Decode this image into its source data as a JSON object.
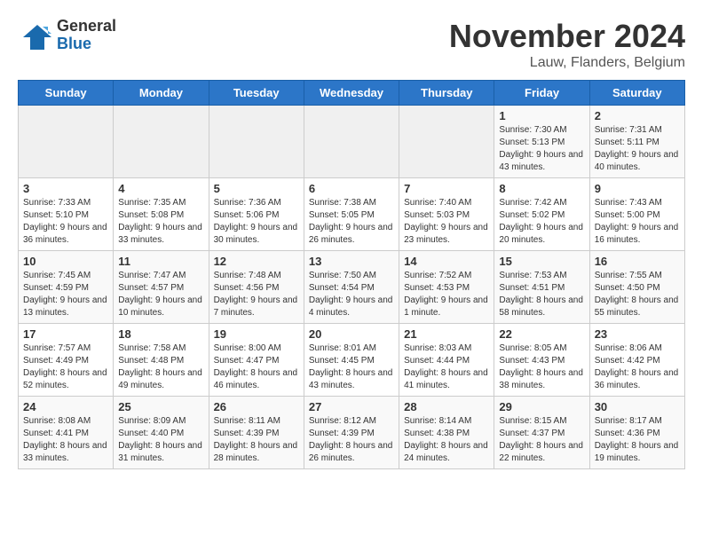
{
  "logo": {
    "general": "General",
    "blue": "Blue"
  },
  "title": "November 2024",
  "subtitle": "Lauw, Flanders, Belgium",
  "days_of_week": [
    "Sunday",
    "Monday",
    "Tuesday",
    "Wednesday",
    "Thursday",
    "Friday",
    "Saturday"
  ],
  "weeks": [
    [
      {
        "day": "",
        "info": ""
      },
      {
        "day": "",
        "info": ""
      },
      {
        "day": "",
        "info": ""
      },
      {
        "day": "",
        "info": ""
      },
      {
        "day": "",
        "info": ""
      },
      {
        "day": "1",
        "info": "Sunrise: 7:30 AM\nSunset: 5:13 PM\nDaylight: 9 hours and 43 minutes."
      },
      {
        "day": "2",
        "info": "Sunrise: 7:31 AM\nSunset: 5:11 PM\nDaylight: 9 hours and 40 minutes."
      }
    ],
    [
      {
        "day": "3",
        "info": "Sunrise: 7:33 AM\nSunset: 5:10 PM\nDaylight: 9 hours and 36 minutes."
      },
      {
        "day": "4",
        "info": "Sunrise: 7:35 AM\nSunset: 5:08 PM\nDaylight: 9 hours and 33 minutes."
      },
      {
        "day": "5",
        "info": "Sunrise: 7:36 AM\nSunset: 5:06 PM\nDaylight: 9 hours and 30 minutes."
      },
      {
        "day": "6",
        "info": "Sunrise: 7:38 AM\nSunset: 5:05 PM\nDaylight: 9 hours and 26 minutes."
      },
      {
        "day": "7",
        "info": "Sunrise: 7:40 AM\nSunset: 5:03 PM\nDaylight: 9 hours and 23 minutes."
      },
      {
        "day": "8",
        "info": "Sunrise: 7:42 AM\nSunset: 5:02 PM\nDaylight: 9 hours and 20 minutes."
      },
      {
        "day": "9",
        "info": "Sunrise: 7:43 AM\nSunset: 5:00 PM\nDaylight: 9 hours and 16 minutes."
      }
    ],
    [
      {
        "day": "10",
        "info": "Sunrise: 7:45 AM\nSunset: 4:59 PM\nDaylight: 9 hours and 13 minutes."
      },
      {
        "day": "11",
        "info": "Sunrise: 7:47 AM\nSunset: 4:57 PM\nDaylight: 9 hours and 10 minutes."
      },
      {
        "day": "12",
        "info": "Sunrise: 7:48 AM\nSunset: 4:56 PM\nDaylight: 9 hours and 7 minutes."
      },
      {
        "day": "13",
        "info": "Sunrise: 7:50 AM\nSunset: 4:54 PM\nDaylight: 9 hours and 4 minutes."
      },
      {
        "day": "14",
        "info": "Sunrise: 7:52 AM\nSunset: 4:53 PM\nDaylight: 9 hours and 1 minute."
      },
      {
        "day": "15",
        "info": "Sunrise: 7:53 AM\nSunset: 4:51 PM\nDaylight: 8 hours and 58 minutes."
      },
      {
        "day": "16",
        "info": "Sunrise: 7:55 AM\nSunset: 4:50 PM\nDaylight: 8 hours and 55 minutes."
      }
    ],
    [
      {
        "day": "17",
        "info": "Sunrise: 7:57 AM\nSunset: 4:49 PM\nDaylight: 8 hours and 52 minutes."
      },
      {
        "day": "18",
        "info": "Sunrise: 7:58 AM\nSunset: 4:48 PM\nDaylight: 8 hours and 49 minutes."
      },
      {
        "day": "19",
        "info": "Sunrise: 8:00 AM\nSunset: 4:47 PM\nDaylight: 8 hours and 46 minutes."
      },
      {
        "day": "20",
        "info": "Sunrise: 8:01 AM\nSunset: 4:45 PM\nDaylight: 8 hours and 43 minutes."
      },
      {
        "day": "21",
        "info": "Sunrise: 8:03 AM\nSunset: 4:44 PM\nDaylight: 8 hours and 41 minutes."
      },
      {
        "day": "22",
        "info": "Sunrise: 8:05 AM\nSunset: 4:43 PM\nDaylight: 8 hours and 38 minutes."
      },
      {
        "day": "23",
        "info": "Sunrise: 8:06 AM\nSunset: 4:42 PM\nDaylight: 8 hours and 36 minutes."
      }
    ],
    [
      {
        "day": "24",
        "info": "Sunrise: 8:08 AM\nSunset: 4:41 PM\nDaylight: 8 hours and 33 minutes."
      },
      {
        "day": "25",
        "info": "Sunrise: 8:09 AM\nSunset: 4:40 PM\nDaylight: 8 hours and 31 minutes."
      },
      {
        "day": "26",
        "info": "Sunrise: 8:11 AM\nSunset: 4:39 PM\nDaylight: 8 hours and 28 minutes."
      },
      {
        "day": "27",
        "info": "Sunrise: 8:12 AM\nSunset: 4:39 PM\nDaylight: 8 hours and 26 minutes."
      },
      {
        "day": "28",
        "info": "Sunrise: 8:14 AM\nSunset: 4:38 PM\nDaylight: 8 hours and 24 minutes."
      },
      {
        "day": "29",
        "info": "Sunrise: 8:15 AM\nSunset: 4:37 PM\nDaylight: 8 hours and 22 minutes."
      },
      {
        "day": "30",
        "info": "Sunrise: 8:17 AM\nSunset: 4:36 PM\nDaylight: 8 hours and 19 minutes."
      }
    ]
  ]
}
